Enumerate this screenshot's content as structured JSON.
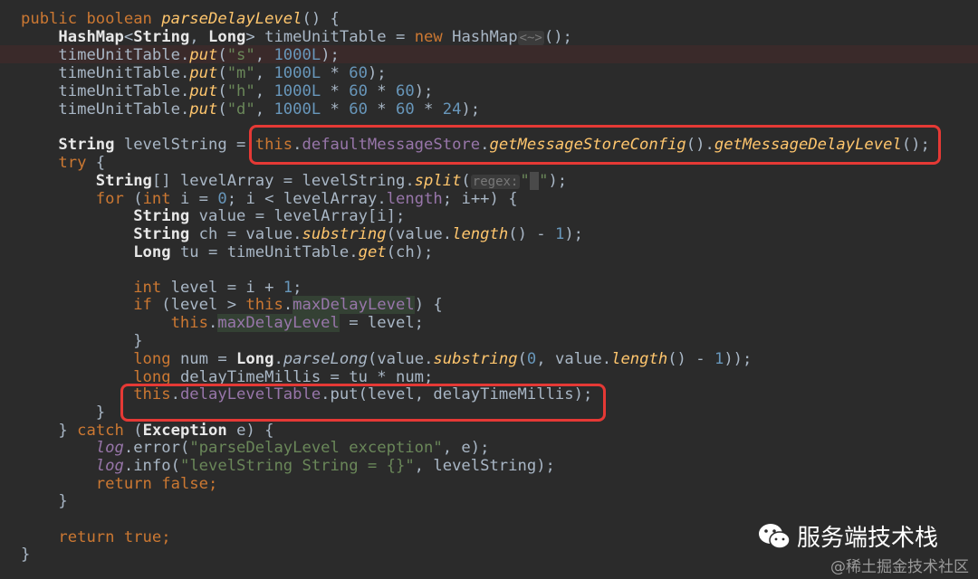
{
  "code": {
    "kw_public": "public",
    "kw_boolean": "boolean",
    "m_parseDelayLevel": "parseDelayLevel",
    "t_open_method": "() {",
    "t_HashMap": "HashMap",
    "t_lt": "<",
    "t_String": "String",
    "t_comma_sp": ", ",
    "t_Long": "Long",
    "t_gt": ">",
    "t_timeUnitTable": "timeUnitTable",
    "t_assign": " = ",
    "kw_new": "new",
    "t_diamond": "<~>",
    "t_paren_semi": "();",
    "m_put": "put",
    "s_s": "\"s\"",
    "s_m": "\"m\"",
    "s_h": "\"h\"",
    "s_d": "\"d\"",
    "n_1000L": "1000L",
    "n_60": "60",
    "n_24": "24",
    "t_times": " * ",
    "t_close_semi": ");",
    "t_dot": ".",
    "t_lp": "(",
    "t_rp": ")",
    "t_levelString": "levelString",
    "kw_this": "this",
    "f_defaultMessageStore": "defaultMessageStore",
    "m_getMessageStoreConfig": "getMessageStoreConfig",
    "m_getMessageDelayLevel": "getMessageDelayLevel",
    "kw_try": "try",
    "t_brace_open": " {",
    "t_arr": "[]",
    "t_levelArray": "levelArray",
    "m_split": "split",
    "hint_regex": "regex:",
    "s_quote_open": "\"",
    "s_quote_close": "\"",
    "kw_for": "for",
    "kw_int": "int",
    "t_i": "i",
    "n_0": "0",
    "t_semi_sp": "; ",
    "t_lt_sp": " < ",
    "f_length": "length",
    "t_ipp": "i++",
    "t_value": "value",
    "t_idx_i": "[i];",
    "t_ch": "ch",
    "m_substring": "substring",
    "m_length": "length",
    "t_minus": " - ",
    "n_1": "1",
    "t_tu": "tu",
    "m_get": "get",
    "t_level": "level",
    "t_plus": " + ",
    "t_semi": ";",
    "kw_if": "if",
    "t_gt_sp": " > ",
    "f_maxDelayLevel": "maxDelayLevel",
    "kw_long": "long",
    "t_num": "num",
    "m_parseLong": "parseLong",
    "t_delayTimeMillis": "delayTimeMillis",
    "f_delayLevelTable": "delayLevelTable",
    "t_brace_close": "}",
    "kw_catch": "catch",
    "t_Exception": "Exception",
    "t_e": "e",
    "f_log": "log",
    "m_error": "error",
    "s_error_msg": "\"parseDelayLevel exception\"",
    "m_info": "info",
    "s_info_msg": "\"levelString String = {}\"",
    "kw_return": "return",
    "kw_false": "false",
    "kw_true": "true"
  },
  "watermark": {
    "channel": "服务端技术栈",
    "site": "@稀土掘金技术社区"
  },
  "colors": {
    "background": "#2b2b2b",
    "keyword": "#cc7832",
    "string": "#6a8759",
    "number": "#6897bb",
    "field": "#9876aa",
    "method": "#ffc66d",
    "highlight_box": "#e53935"
  },
  "icons": {
    "watermark_logo": "wechat-icon"
  }
}
